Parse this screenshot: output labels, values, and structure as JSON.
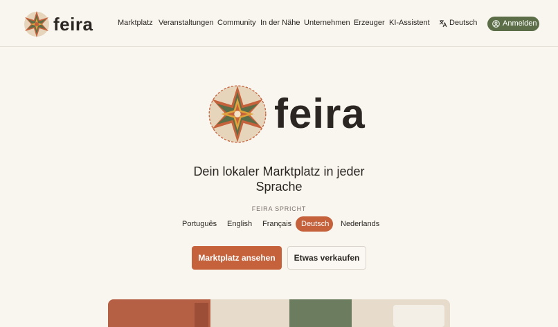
{
  "brand": {
    "name": "feira"
  },
  "header": {
    "nav": [
      {
        "label": "Marktplatz"
      },
      {
        "label": "Veranstaltungen"
      },
      {
        "label": "Community"
      },
      {
        "label": "In der Nähe"
      },
      {
        "label": "Unternehmen"
      },
      {
        "label": "Erzeuger"
      },
      {
        "label": "KI-Assistent"
      }
    ],
    "language": "Deutsch",
    "signin": "Anmelden"
  },
  "hero": {
    "tagline": "Dein lokaler Marktplatz in jeder Sprache",
    "speaks": "FEIRA SPRICHT",
    "languages": [
      "Português",
      "English",
      "Français",
      "Deutsch",
      "Nederlands"
    ],
    "active_language": "Deutsch",
    "primary_button": "Marktplatz ansehen",
    "secondary_button": "Etwas verkaufen"
  },
  "colors": {
    "accent": "#c5613b",
    "green": "#5b6e47",
    "background": "#f9f5ef",
    "text": "#2b2622"
  }
}
